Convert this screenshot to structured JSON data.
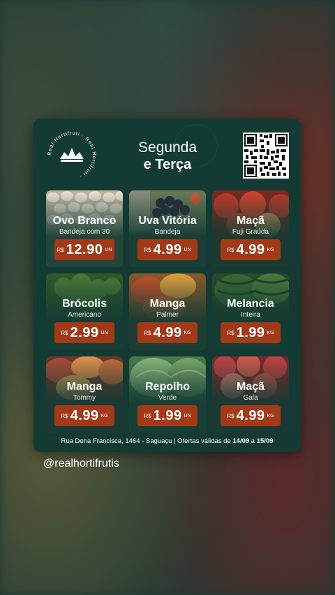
{
  "logo": {
    "ring_text": "Real Hortifruti · Real Hortifruti ·"
  },
  "header": {
    "title_line1": "Segunda",
    "title_line2": "e Terça"
  },
  "products": [
    {
      "name": "Ovo Branco",
      "sub": "Bandeja com 30",
      "currency": "R$",
      "price": "12.90",
      "unit": "UN",
      "photo": "eggs"
    },
    {
      "name": "Uva Vitória",
      "sub": "Bandeja",
      "currency": "R$",
      "price": "4.99",
      "unit": "UN",
      "photo": "grapes"
    },
    {
      "name": "Maçã",
      "sub": "Fuji Graúda",
      "currency": "R$",
      "price": "4.99",
      "unit": "KG",
      "photo": "apples-red"
    },
    {
      "name": "Brócolis",
      "sub": "Americano",
      "currency": "R$",
      "price": "2.99",
      "unit": "UN",
      "photo": "broccoli"
    },
    {
      "name": "Manga",
      "sub": "Palmer",
      "currency": "R$",
      "price": "4.99",
      "unit": "KG",
      "photo": "mango-palmer"
    },
    {
      "name": "Melancia",
      "sub": "Inteira",
      "currency": "R$",
      "price": "1.99",
      "unit": "KG",
      "photo": "watermelon"
    },
    {
      "name": "Manga",
      "sub": "Tommy",
      "currency": "R$",
      "price": "4.99",
      "unit": "KG",
      "photo": "mango-tommy"
    },
    {
      "name": "Repolho",
      "sub": "Verde",
      "currency": "R$",
      "price": "1.99",
      "unit": "UN",
      "photo": "cabbage"
    },
    {
      "name": "Maçã",
      "sub": "Gala",
      "currency": "R$",
      "price": "4.99",
      "unit": "KG",
      "photo": "apples-gala"
    }
  ],
  "footer": {
    "text_prefix": "Rua Dona Francisca, 1464 - Saguaçu | Ofertas válidas de ",
    "date_from": "14/09",
    "text_mid": " a ",
    "date_to": "15/09"
  },
  "handle": "@realhortifrutis",
  "colors": {
    "card": "#143a34",
    "price_badge": "#a23a1a",
    "text": "#ffffff"
  }
}
